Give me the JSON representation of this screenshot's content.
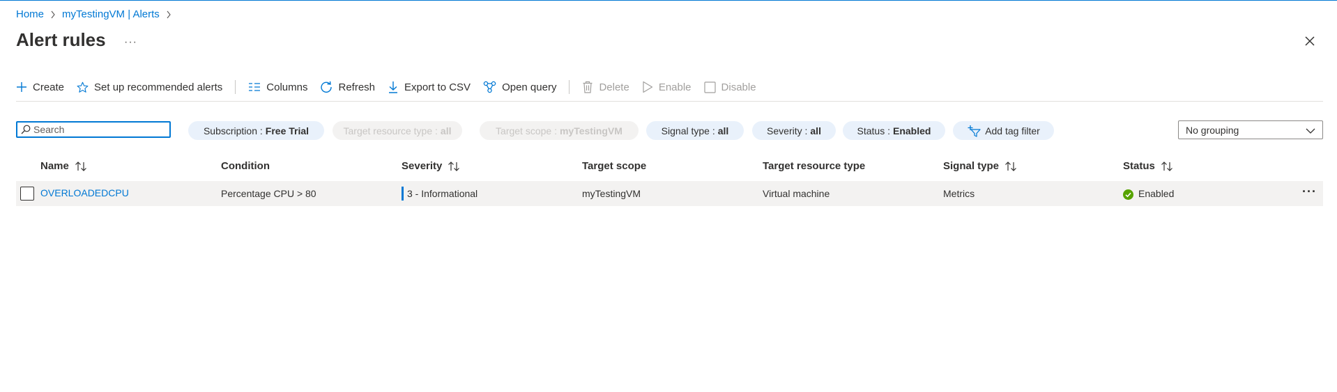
{
  "breadcrumb": {
    "items": [
      "Home",
      "myTestingVM | Alerts"
    ]
  },
  "page": {
    "title": "Alert rules",
    "more": "···"
  },
  "toolbar": {
    "create": "Create",
    "recommended": "Set up recommended alerts",
    "columns": "Columns",
    "refresh": "Refresh",
    "export": "Export to CSV",
    "open_query": "Open query",
    "delete": "Delete",
    "enable": "Enable",
    "disable": "Disable"
  },
  "search": {
    "placeholder": "Search",
    "value": ""
  },
  "filters": [
    {
      "label": "Subscription :",
      "value": "Free Trial",
      "enabled": true
    },
    {
      "label": "Target resource type :",
      "value": "all",
      "enabled": false
    },
    {
      "label": "Target scope :",
      "value": "myTestingVM",
      "enabled": false
    },
    {
      "label": "Signal type :",
      "value": "all",
      "enabled": true
    },
    {
      "label": "Severity :",
      "value": "all",
      "enabled": true
    },
    {
      "label": "Status :",
      "value": "Enabled",
      "enabled": true
    }
  ],
  "add_tag_filter": "Add tag filter",
  "grouping": {
    "selected": "No grouping"
  },
  "table": {
    "headers": [
      "Name",
      "Condition",
      "Severity",
      "Target scope",
      "Target resource type",
      "Signal type",
      "Status"
    ],
    "rows": [
      {
        "name": "OVERLOADEDCPU",
        "condition": "Percentage CPU > 80",
        "severity": "3 - Informational",
        "target_scope": "myTestingVM",
        "target_resource_type": "Virtual machine",
        "signal_type": "Metrics",
        "status": "Enabled"
      }
    ]
  },
  "colors": {
    "accent": "#0078d4",
    "success": "#57a300",
    "disabled": "#a19f9d"
  }
}
